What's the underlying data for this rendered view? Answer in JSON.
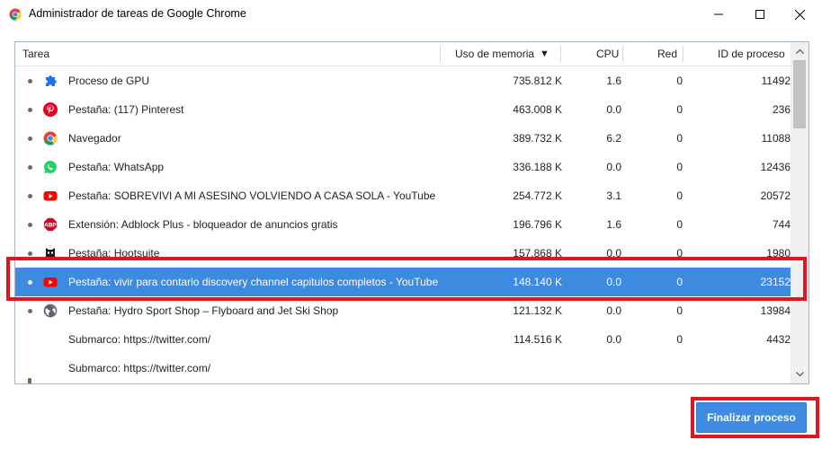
{
  "window": {
    "title": "Administrador de tareas de Google Chrome",
    "icon": "chrome-icon",
    "controls": {
      "minimize": "minimize-icon",
      "maximize": "maximize-icon",
      "close": "close-icon"
    }
  },
  "table": {
    "columns": {
      "task": "Tarea",
      "memory": "Uso de memoria",
      "sort_indicator": "▼",
      "cpu": "CPU",
      "network": "Red",
      "pid": "ID de proceso"
    },
    "rows": [
      {
        "icon": "puzzle-icon",
        "name": "Proceso de GPU",
        "memory": "735.812 K",
        "cpu": "1.6",
        "network": "0",
        "pid": "11492",
        "selected": false
      },
      {
        "icon": "pinterest-icon",
        "name": "Pestaña: (117) Pinterest",
        "memory": "463.008 K",
        "cpu": "0.0",
        "network": "0",
        "pid": "236",
        "selected": false
      },
      {
        "icon": "chrome-icon",
        "name": "Navegador",
        "memory": "389.732 K",
        "cpu": "6.2",
        "network": "0",
        "pid": "11088",
        "selected": false
      },
      {
        "icon": "whatsapp-icon",
        "name": "Pestaña: WhatsApp",
        "memory": "336.188 K",
        "cpu": "0.0",
        "network": "0",
        "pid": "12436",
        "selected": false
      },
      {
        "icon": "youtube-icon",
        "name": "Pestaña: SOBREVIVI A MI ASESINO VOLVIENDO A CASA SOLA - YouTube",
        "memory": "254.772 K",
        "cpu": "3.1",
        "network": "0",
        "pid": "20572",
        "selected": false
      },
      {
        "icon": "adblock-icon",
        "name": "Extensión: Adblock Plus - bloqueador de anuncios gratis",
        "memory": "196.796 K",
        "cpu": "1.6",
        "network": "0",
        "pid": "744",
        "selected": false
      },
      {
        "icon": "hootsuite-icon",
        "name": "Pestaña: Hootsuite",
        "memory": "157.868 K",
        "cpu": "0.0",
        "network": "0",
        "pid": "1980",
        "selected": false
      },
      {
        "icon": "youtube-icon",
        "name": "Pestaña: vivir para contarlo discovery channel capitulos completos - YouTube",
        "memory": "148.140 K",
        "cpu": "0.0",
        "network": "0",
        "pid": "23152",
        "selected": true
      },
      {
        "icon": "globe-icon",
        "name": "Pestaña: Hydro Sport Shop – Flyboard and Jet Ski Shop",
        "memory": "121.132 K",
        "cpu": "0.0",
        "network": "0",
        "pid": "13984",
        "selected": false
      },
      {
        "icon": "",
        "name": "Submarco: https://twitter.com/",
        "memory": "114.516 K",
        "cpu": "0.0",
        "network": "0",
        "pid": "4432",
        "selected": false
      },
      {
        "icon": "",
        "name": "Submarco: https://twitter.com/",
        "memory": "",
        "cpu": "",
        "network": "",
        "pid": "",
        "selected": false
      }
    ]
  },
  "actions": {
    "end_process": "Finalizar proceso"
  },
  "colors": {
    "selection": "#3d8ae0",
    "highlight": "#e2141e",
    "button": "#3f8ae2"
  }
}
